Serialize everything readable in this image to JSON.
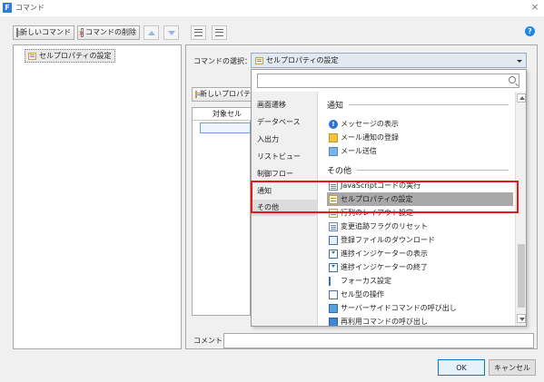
{
  "window": {
    "title": "コマンド",
    "icon_letter": "F"
  },
  "toolbar": {
    "new_command": "新しいコマンド",
    "delete_command": "コマンドの削除"
  },
  "tree": {
    "items": [
      {
        "label": "セルプロパティの設定"
      }
    ]
  },
  "editor": {
    "command_select_label": "コマンドの選択：",
    "command_select_value": "セルプロパティの設定",
    "new_property_button": "新しいプロパティ",
    "target_cell_header": "対象セル",
    "comment_label": "コメント"
  },
  "dropdown": {
    "search_placeholder": "",
    "categories": [
      {
        "label": "画面遷移"
      },
      {
        "label": "データベース"
      },
      {
        "label": "入出力"
      },
      {
        "label": "リストビュー"
      },
      {
        "label": "制御フロー"
      },
      {
        "label": "通知"
      },
      {
        "label": "その他"
      }
    ],
    "active_category": "その他",
    "sections": [
      {
        "header": "通知",
        "items": [
          "メッセージの表示",
          "メール通知の登録",
          "メール送信"
        ]
      },
      {
        "header": "その他",
        "items": [
          "JavaScriptコードの実行",
          "セルプロパティの設定",
          "行列のレイアウト設定",
          "変更追跡フラグのリセット",
          "登録ファイルのダウンロード",
          "進捗インジケーターの表示",
          "進捗インジケーターの終了",
          "フォーカス設定",
          "セル型の操作",
          "サーバーサイドコマンドの呼び出し",
          "再利用コマンドの呼び出し"
        ]
      }
    ],
    "selected_item": "セルプロパティの設定"
  },
  "footer": {
    "ok": "OK",
    "cancel": "キャンセル"
  },
  "colors": {
    "highlight_box": "#e3191c",
    "selected_row": "#a9a9a9",
    "help_icon": "#1e88e5"
  }
}
